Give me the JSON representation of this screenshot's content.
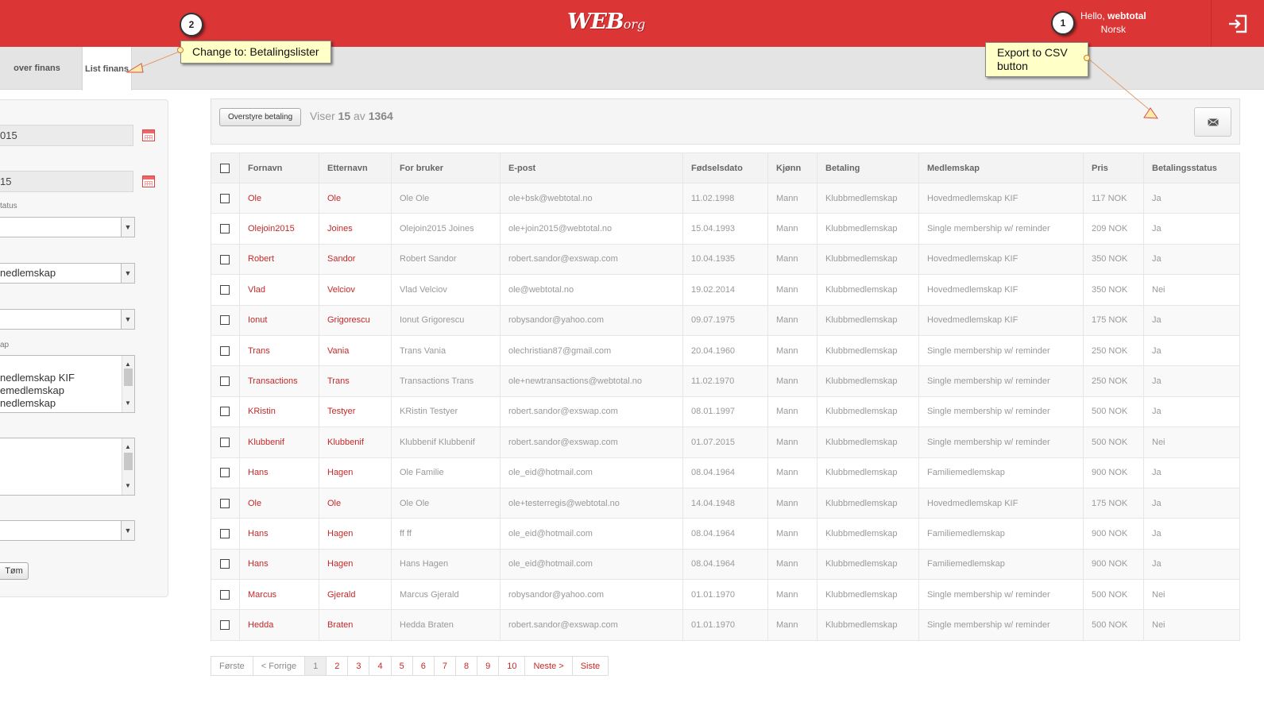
{
  "header": {
    "logo_main": "WEB",
    "logo_rest": "org",
    "greeting_prefix": "Hello,",
    "username": "webtotal",
    "language": "Norsk"
  },
  "tabs": [
    {
      "label": "over finans",
      "active": false
    },
    {
      "label": "List finans",
      "active": true
    }
  ],
  "filters": {
    "date_from": "015",
    "date_to": "15",
    "status_label": "tatus",
    "status_value": "",
    "type_value": "nedlemskap",
    "select3_value": "",
    "membership_label": "ap",
    "membership_options": [
      "nedlemskap KIF",
      "emedlemskap",
      "nedlemskap"
    ],
    "select4_value": "",
    "clear_label": "Tøm"
  },
  "toolbar": {
    "override_label": "Overstyre betaling",
    "showing_prefix": "Viser",
    "showing_count": "15",
    "showing_of": "av",
    "showing_total": "1364",
    "export_icon": "mail-icon"
  },
  "table": {
    "columns": [
      "Fornavn",
      "Etternavn",
      "For bruker",
      "E-post",
      "Fødselsdato",
      "Kjønn",
      "Betaling",
      "Medlemskap",
      "Pris",
      "Betalingsstatus"
    ],
    "rows": [
      [
        "Ole",
        "Ole",
        "Ole Ole",
        "ole+bsk@webtotal.no",
        "11.02.1998",
        "Mann",
        "Klubbmedlemskap",
        "Hovedmedlemskap KIF",
        "117 NOK",
        "Ja"
      ],
      [
        "Olejoin2015",
        "Joines",
        "Olejoin2015 Joines",
        "ole+join2015@webtotal.no",
        "15.04.1993",
        "Mann",
        "Klubbmedlemskap",
        "Single membership w/ reminder",
        "209 NOK",
        "Ja"
      ],
      [
        "Robert",
        "Sandor",
        "Robert Sandor",
        "robert.sandor@exswap.com",
        "10.04.1935",
        "Mann",
        "Klubbmedlemskap",
        "Hovedmedlemskap KIF",
        "350 NOK",
        "Ja"
      ],
      [
        "Vlad",
        "Velciov",
        "Vlad Velciov",
        "ole@webtotal.no",
        "19.02.2014",
        "Mann",
        "Klubbmedlemskap",
        "Hovedmedlemskap KIF",
        "350 NOK",
        "Nei"
      ],
      [
        "Ionut",
        "Grigorescu",
        "Ionut Grigorescu",
        "robysandor@yahoo.com",
        "09.07.1975",
        "Mann",
        "Klubbmedlemskap",
        "Hovedmedlemskap KIF",
        "175 NOK",
        "Ja"
      ],
      [
        "Trans",
        "Vania",
        "Trans Vania",
        "olechristian87@gmail.com",
        "20.04.1960",
        "Mann",
        "Klubbmedlemskap",
        "Single membership w/ reminder",
        "250 NOK",
        "Ja"
      ],
      [
        "Transactions",
        "Trans",
        "Transactions Trans",
        "ole+newtransactions@webtotal.no",
        "11.02.1970",
        "Mann",
        "Klubbmedlemskap",
        "Single membership w/ reminder",
        "250 NOK",
        "Ja"
      ],
      [
        "KRistin",
        "Testyer",
        "KRistin Testyer",
        "robert.sandor@exswap.com",
        "08.01.1997",
        "Mann",
        "Klubbmedlemskap",
        "Single membership w/ reminder",
        "500 NOK",
        "Ja"
      ],
      [
        "Klubbenif",
        "Klubbenif",
        "Klubbenif Klubbenif",
        "robert.sandor@exswap.com",
        "01.07.2015",
        "Mann",
        "Klubbmedlemskap",
        "Single membership w/ reminder",
        "500 NOK",
        "Nei"
      ],
      [
        "Hans",
        "Hagen",
        "Ole Familie",
        "ole_eid@hotmail.com",
        "08.04.1964",
        "Mann",
        "Klubbmedlemskap",
        "Familiemedlemskap",
        "900 NOK",
        "Ja"
      ],
      [
        "Ole",
        "Ole",
        "Ole Ole",
        "ole+testerregis@webtotal.no",
        "14.04.1948",
        "Mann",
        "Klubbmedlemskap",
        "Hovedmedlemskap KIF",
        "175 NOK",
        "Ja"
      ],
      [
        "Hans",
        "Hagen",
        "ff ff",
        "ole_eid@hotmail.com",
        "08.04.1964",
        "Mann",
        "Klubbmedlemskap",
        "Familiemedlemskap",
        "900 NOK",
        "Ja"
      ],
      [
        "Hans",
        "Hagen",
        "Hans Hagen",
        "ole_eid@hotmail.com",
        "08.04.1964",
        "Mann",
        "Klubbmedlemskap",
        "Familiemedlemskap",
        "900 NOK",
        "Ja"
      ],
      [
        "Marcus",
        "Gjerald",
        "Marcus Gjerald",
        "robysandor@yahoo.com",
        "01.01.1970",
        "Mann",
        "Klubbmedlemskap",
        "Single membership w/ reminder",
        "500 NOK",
        "Nei"
      ],
      [
        "Hedda",
        "Braten",
        "Hedda Braten",
        "robert.sandor@exswap.com",
        "01.01.1970",
        "Mann",
        "Klubbmedlemskap",
        "Single membership w/ reminder",
        "500 NOK",
        "Nei"
      ]
    ]
  },
  "pagination": {
    "first": "Første",
    "prev": "< Forrige",
    "pages": [
      "1",
      "2",
      "3",
      "4",
      "5",
      "6",
      "7",
      "8",
      "9",
      "10"
    ],
    "current": "1",
    "next": "Neste >",
    "last": "Siste"
  },
  "annotations": [
    {
      "number": "2",
      "text": "Change to: Betalingslister"
    },
    {
      "number": "1",
      "text": "Export to CSV button"
    }
  ],
  "colors": {
    "brand_red": "#dc3535",
    "link_red": "#c62828",
    "note_yellow": "#ffffc8"
  }
}
